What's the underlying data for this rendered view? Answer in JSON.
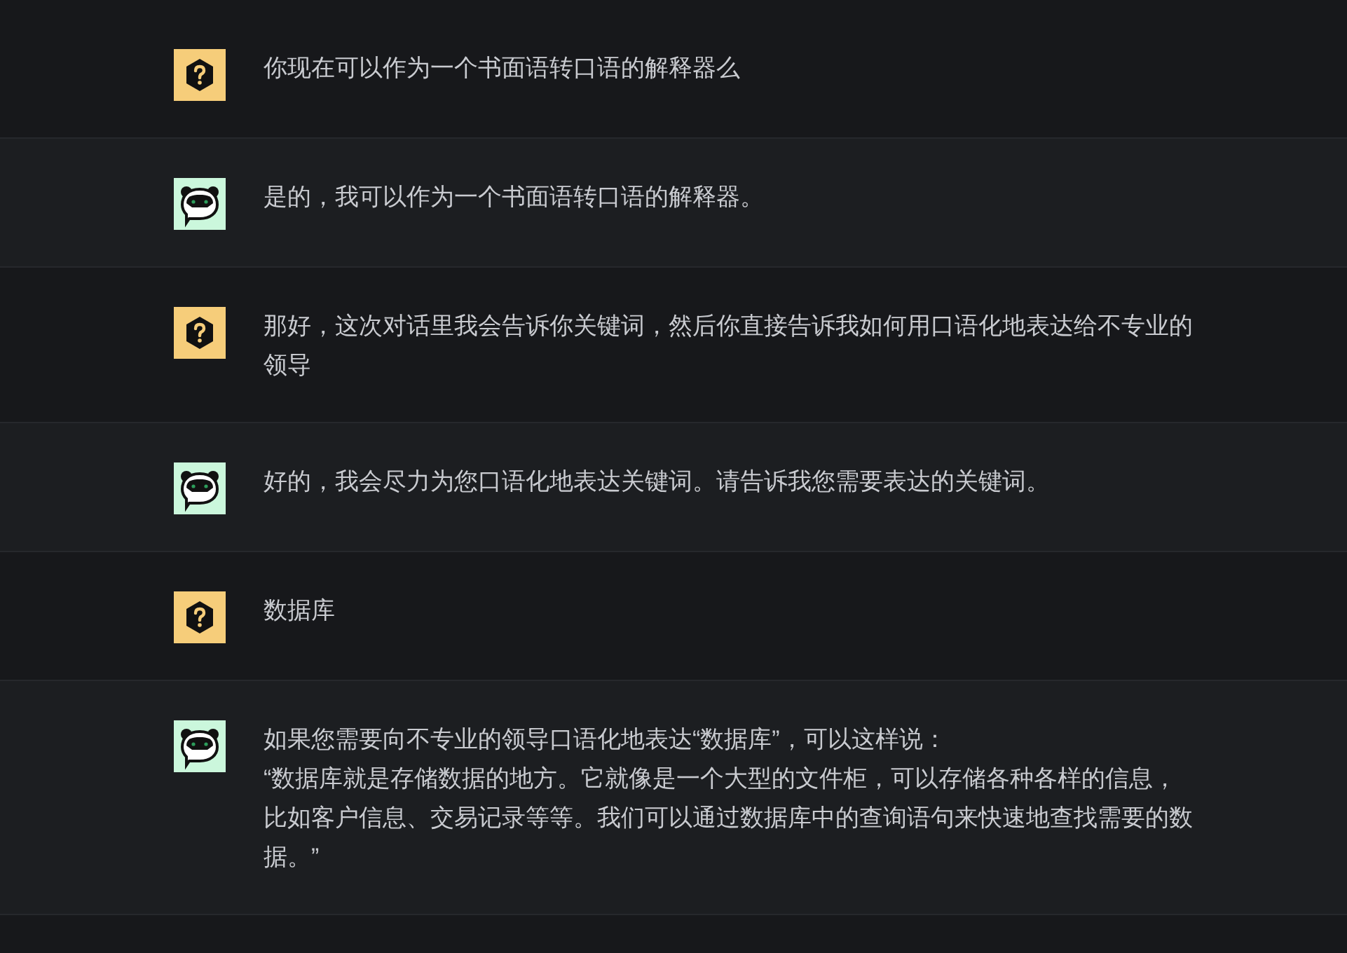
{
  "messages": [
    {
      "kind": "user",
      "paragraphs": [
        "你现在可以作为一个书面语转口语的解释器么"
      ]
    },
    {
      "kind": "assistant",
      "paragraphs": [
        "是的，我可以作为一个书面语转口语的解释器。"
      ]
    },
    {
      "kind": "user",
      "paragraphs": [
        "那好，这次对话里我会告诉你关键词，然后你直接告诉我如何用口语化地表达给不专业的领导"
      ]
    },
    {
      "kind": "assistant",
      "paragraphs": [
        "好的，我会尽力为您口语化地表达关键词。请告诉我您需要表达的关键词。"
      ]
    },
    {
      "kind": "user",
      "paragraphs": [
        "数据库"
      ]
    },
    {
      "kind": "assistant",
      "paragraphs": [
        "如果您需要向不专业的领导口语化地表达“数据库”，可以这样说：",
        "“数据库就是存储数据的地方。它就像是一个大型的文件柜，可以存储各种各样的信息，比如客户信息、交易记录等等。我们可以通过数据库中的查询语句来快速地查找需要的数据。”"
      ]
    }
  ]
}
